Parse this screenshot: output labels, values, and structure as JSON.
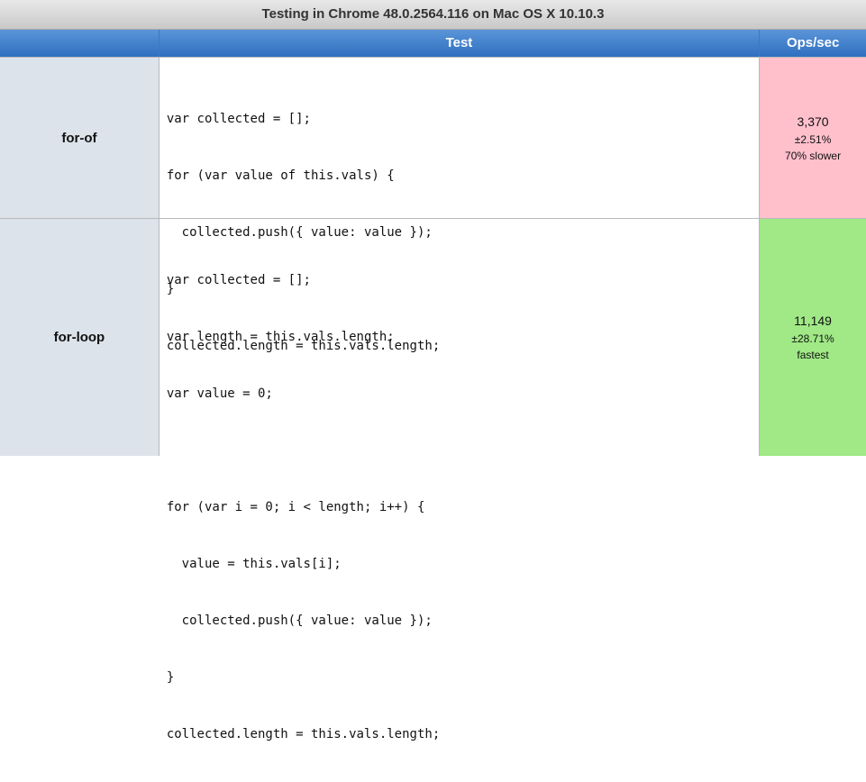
{
  "caption": "Testing in Chrome 48.0.2564.116 on Mac OS X 10.10.3",
  "header": {
    "test_label": "Test",
    "ops_label": "Ops/sec"
  },
  "colors": {
    "slower_bg": "#ffc0cb",
    "fastest_bg": "#a0e986",
    "header_blue": "#3b7dd0"
  },
  "tests": [
    {
      "name": "for-of",
      "code_lines": [
        "var collected = [];",
        "for (var value of this.vals) {",
        "  collected.push({ value: value });",
        "}",
        "collected.length = this.vals.length;"
      ],
      "ops": "3,370",
      "rme": "±2.51%",
      "status": "70% slower"
    },
    {
      "name": "for-loop",
      "code_lines": [
        "var collected = [];",
        "var length = this.vals.length;",
        "var value = 0;",
        "",
        "for (var i = 0; i < length; i++) {",
        "  value = this.vals[i];",
        "  collected.push({ value: value });",
        "}",
        "collected.length = this.vals.length;"
      ],
      "ops": "11,149",
      "rme": "±28.71%",
      "status": "fastest"
    }
  ]
}
